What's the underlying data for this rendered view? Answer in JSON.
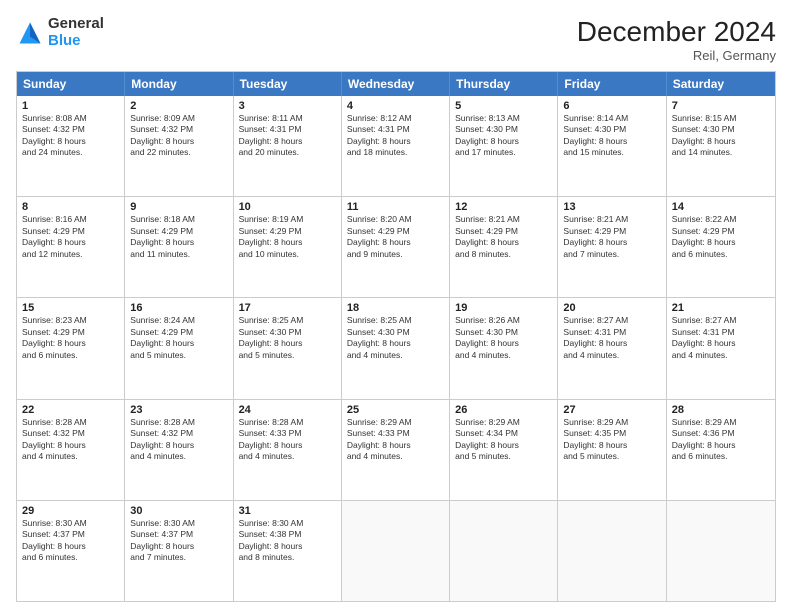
{
  "logo": {
    "general": "General",
    "blue": "Blue"
  },
  "title": "December 2024",
  "location": "Reil, Germany",
  "days_of_week": [
    "Sunday",
    "Monday",
    "Tuesday",
    "Wednesday",
    "Thursday",
    "Friday",
    "Saturday"
  ],
  "weeks": [
    [
      {
        "day": "1",
        "info": "Sunrise: 8:08 AM\nSunset: 4:32 PM\nDaylight: 8 hours\nand 24 minutes."
      },
      {
        "day": "2",
        "info": "Sunrise: 8:09 AM\nSunset: 4:32 PM\nDaylight: 8 hours\nand 22 minutes."
      },
      {
        "day": "3",
        "info": "Sunrise: 8:11 AM\nSunset: 4:31 PM\nDaylight: 8 hours\nand 20 minutes."
      },
      {
        "day": "4",
        "info": "Sunrise: 8:12 AM\nSunset: 4:31 PM\nDaylight: 8 hours\nand 18 minutes."
      },
      {
        "day": "5",
        "info": "Sunrise: 8:13 AM\nSunset: 4:30 PM\nDaylight: 8 hours\nand 17 minutes."
      },
      {
        "day": "6",
        "info": "Sunrise: 8:14 AM\nSunset: 4:30 PM\nDaylight: 8 hours\nand 15 minutes."
      },
      {
        "day": "7",
        "info": "Sunrise: 8:15 AM\nSunset: 4:30 PM\nDaylight: 8 hours\nand 14 minutes."
      }
    ],
    [
      {
        "day": "8",
        "info": "Sunrise: 8:16 AM\nSunset: 4:29 PM\nDaylight: 8 hours\nand 12 minutes."
      },
      {
        "day": "9",
        "info": "Sunrise: 8:18 AM\nSunset: 4:29 PM\nDaylight: 8 hours\nand 11 minutes."
      },
      {
        "day": "10",
        "info": "Sunrise: 8:19 AM\nSunset: 4:29 PM\nDaylight: 8 hours\nand 10 minutes."
      },
      {
        "day": "11",
        "info": "Sunrise: 8:20 AM\nSunset: 4:29 PM\nDaylight: 8 hours\nand 9 minutes."
      },
      {
        "day": "12",
        "info": "Sunrise: 8:21 AM\nSunset: 4:29 PM\nDaylight: 8 hours\nand 8 minutes."
      },
      {
        "day": "13",
        "info": "Sunrise: 8:21 AM\nSunset: 4:29 PM\nDaylight: 8 hours\nand 7 minutes."
      },
      {
        "day": "14",
        "info": "Sunrise: 8:22 AM\nSunset: 4:29 PM\nDaylight: 8 hours\nand 6 minutes."
      }
    ],
    [
      {
        "day": "15",
        "info": "Sunrise: 8:23 AM\nSunset: 4:29 PM\nDaylight: 8 hours\nand 6 minutes."
      },
      {
        "day": "16",
        "info": "Sunrise: 8:24 AM\nSunset: 4:29 PM\nDaylight: 8 hours\nand 5 minutes."
      },
      {
        "day": "17",
        "info": "Sunrise: 8:25 AM\nSunset: 4:30 PM\nDaylight: 8 hours\nand 5 minutes."
      },
      {
        "day": "18",
        "info": "Sunrise: 8:25 AM\nSunset: 4:30 PM\nDaylight: 8 hours\nand 4 minutes."
      },
      {
        "day": "19",
        "info": "Sunrise: 8:26 AM\nSunset: 4:30 PM\nDaylight: 8 hours\nand 4 minutes."
      },
      {
        "day": "20",
        "info": "Sunrise: 8:27 AM\nSunset: 4:31 PM\nDaylight: 8 hours\nand 4 minutes."
      },
      {
        "day": "21",
        "info": "Sunrise: 8:27 AM\nSunset: 4:31 PM\nDaylight: 8 hours\nand 4 minutes."
      }
    ],
    [
      {
        "day": "22",
        "info": "Sunrise: 8:28 AM\nSunset: 4:32 PM\nDaylight: 8 hours\nand 4 minutes."
      },
      {
        "day": "23",
        "info": "Sunrise: 8:28 AM\nSunset: 4:32 PM\nDaylight: 8 hours\nand 4 minutes."
      },
      {
        "day": "24",
        "info": "Sunrise: 8:28 AM\nSunset: 4:33 PM\nDaylight: 8 hours\nand 4 minutes."
      },
      {
        "day": "25",
        "info": "Sunrise: 8:29 AM\nSunset: 4:33 PM\nDaylight: 8 hours\nand 4 minutes."
      },
      {
        "day": "26",
        "info": "Sunrise: 8:29 AM\nSunset: 4:34 PM\nDaylight: 8 hours\nand 5 minutes."
      },
      {
        "day": "27",
        "info": "Sunrise: 8:29 AM\nSunset: 4:35 PM\nDaylight: 8 hours\nand 5 minutes."
      },
      {
        "day": "28",
        "info": "Sunrise: 8:29 AM\nSunset: 4:36 PM\nDaylight: 8 hours\nand 6 minutes."
      }
    ],
    [
      {
        "day": "29",
        "info": "Sunrise: 8:30 AM\nSunset: 4:37 PM\nDaylight: 8 hours\nand 6 minutes."
      },
      {
        "day": "30",
        "info": "Sunrise: 8:30 AM\nSunset: 4:37 PM\nDaylight: 8 hours\nand 7 minutes."
      },
      {
        "day": "31",
        "info": "Sunrise: 8:30 AM\nSunset: 4:38 PM\nDaylight: 8 hours\nand 8 minutes."
      },
      {
        "day": "",
        "info": ""
      },
      {
        "day": "",
        "info": ""
      },
      {
        "day": "",
        "info": ""
      },
      {
        "day": "",
        "info": ""
      }
    ]
  ]
}
